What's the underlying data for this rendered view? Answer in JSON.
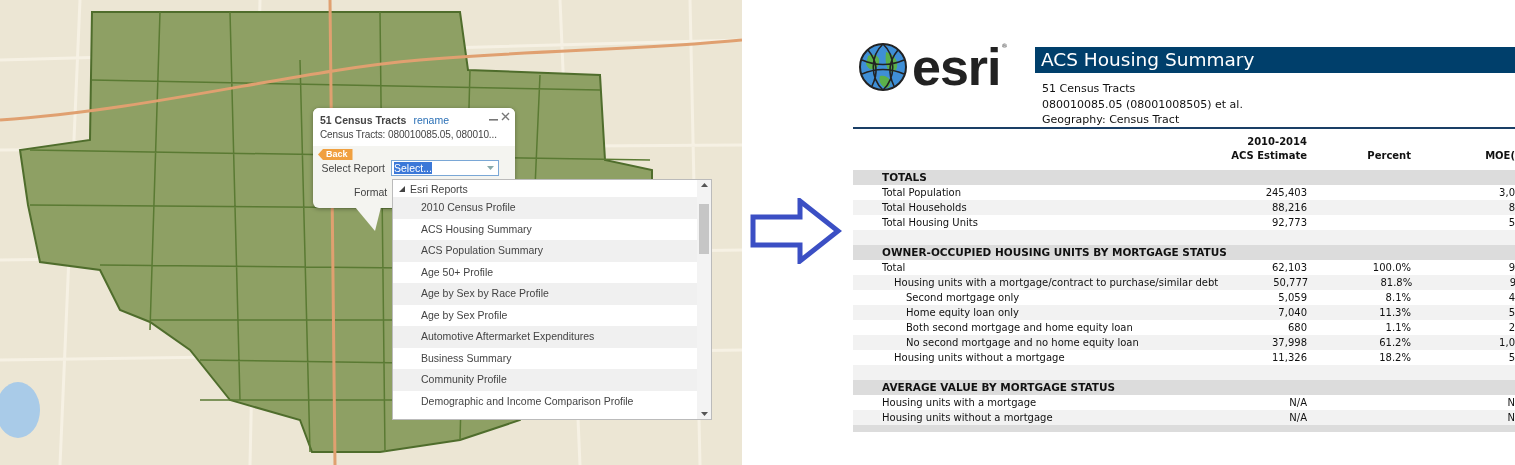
{
  "map": {
    "popup": {
      "title": "51 Census Tracts",
      "rename_link": "rename",
      "subtitle": "Census Tracts: 080010085.05, 080010...",
      "back_button": "Back",
      "select_label": "Select Report",
      "select_value": "Select...",
      "format_label": "Format"
    },
    "dropdown": {
      "groups": [
        {
          "label": "Esri Reports",
          "expanded": true,
          "children": [
            {
              "label": "2010 Census Profile"
            },
            {
              "label": "ACS Housing Summary"
            },
            {
              "label": "ACS Population Summary"
            },
            {
              "label": "Age 50+ Profile"
            },
            {
              "label": "Age by Sex by Race Profile"
            },
            {
              "label": "Age by Sex Profile"
            },
            {
              "label": "Automotive Aftermarket Expenditures"
            },
            {
              "label": "Business Summary"
            },
            {
              "label": "Community Profile"
            },
            {
              "label": "Demographic and Income Comparison Profile"
            }
          ]
        }
      ]
    }
  },
  "report": {
    "logo_text": "esri",
    "logo_mark": "®",
    "title": "ACS Housing Summary",
    "info": [
      "51 Census Tracts",
      "080010085.05 (08001008505) et al.",
      "Geography: Census Tract"
    ],
    "columns": [
      {
        "lines": [
          "2010-2014",
          "ACS Estimate"
        ]
      },
      {
        "lines": [
          "Percent"
        ]
      },
      {
        "lines": [
          "MOE("
        ]
      }
    ],
    "rows": [
      {
        "kind": "section",
        "label": "TOTALS"
      },
      {
        "kind": "row",
        "label": "Total Population",
        "estimate": "245,403",
        "moe": "3,0"
      },
      {
        "kind": "row",
        "label": "Total Households",
        "estimate": "88,216",
        "moe": "8"
      },
      {
        "kind": "row",
        "label": "Total Housing Units",
        "estimate": "92,773",
        "moe": "5"
      },
      {
        "kind": "spacer"
      },
      {
        "kind": "section",
        "label": "OWNER-OCCUPIED HOUSING UNITS BY MORTGAGE STATUS"
      },
      {
        "kind": "row",
        "label": "Total",
        "estimate": "62,103",
        "percent": "100.0%",
        "moe": "9",
        "children": [
          {
            "label": "Housing units with a mortgage/contract to purchase/similar debt",
            "estimate": "50,777",
            "percent": "81.8%",
            "moe": "9",
            "children": [
              {
                "label": "Second mortgage only",
                "estimate": "5,059",
                "percent": "8.1%",
                "moe": "4"
              },
              {
                "label": "Home equity loan only",
                "estimate": "7,040",
                "percent": "11.3%",
                "moe": "5"
              },
              {
                "label": "Both second mortgage and home equity loan",
                "estimate": "680",
                "percent": "1.1%",
                "moe": "2"
              },
              {
                "label": "No second mortgage and no home equity loan",
                "estimate": "37,998",
                "percent": "61.2%",
                "moe": "1,0"
              }
            ]
          },
          {
            "label": "Housing units without a mortgage",
            "estimate": "11,326",
            "percent": "18.2%",
            "moe": "5"
          }
        ]
      },
      {
        "kind": "spacer"
      },
      {
        "kind": "section",
        "label": "AVERAGE VALUE BY MORTGAGE STATUS"
      },
      {
        "kind": "row",
        "label": "Housing units with a mortgage",
        "estimate": "N/A",
        "moe": "N"
      },
      {
        "kind": "row",
        "label": "Housing units without a mortgage",
        "estimate": "N/A",
        "moe": "N"
      },
      {
        "kind": "section"
      }
    ]
  }
}
